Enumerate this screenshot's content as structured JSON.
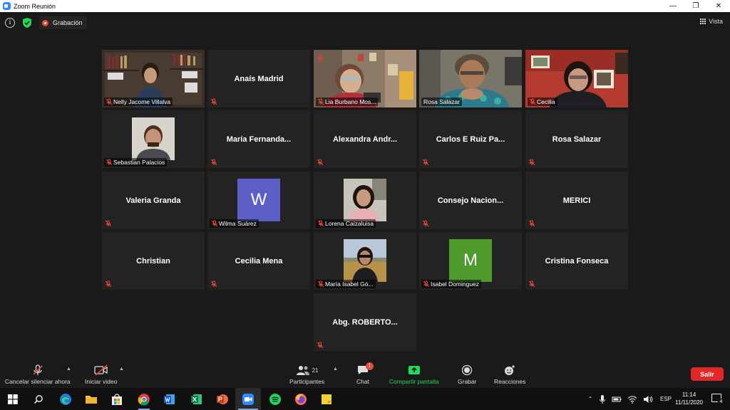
{
  "window": {
    "title": "Zoom Reunión",
    "controls": [
      "—",
      "❐",
      "✕"
    ]
  },
  "topbar": {
    "recording_label": "Grabación",
    "view_label": "Vista"
  },
  "participants": [
    {
      "name": "Nelly Jacome Villalva"
    },
    {
      "name": "Anaís Madrid"
    },
    {
      "name": "Lia Burbano Mos..."
    },
    {
      "name": "Rosa Salazar"
    },
    {
      "name": "Cecilia"
    },
    {
      "name": "Sebastian Palacios"
    },
    {
      "name": "María  Fernanda..."
    },
    {
      "name": "Alexandra  Andr..."
    },
    {
      "name": "Carlos E Ruiz Pa..."
    },
    {
      "name": "Rosa Salazar"
    },
    {
      "name": "Valeria Granda"
    },
    {
      "name": "Wilma Suárez",
      "avatar_letter": "W",
      "avatar_color": "#5b5fc7"
    },
    {
      "name": "Lorena Caizaluisa"
    },
    {
      "name": "Consejo  Nacion..."
    },
    {
      "name": "MERICI"
    },
    {
      "name": "Christian"
    },
    {
      "name": "Cecilia Mena"
    },
    {
      "name": "María Isabel Gó..."
    },
    {
      "name": "Isabel Dominguez",
      "avatar_letter": "M",
      "avatar_color": "#4e9a2d"
    },
    {
      "name": "Cristina Fonseca"
    },
    {
      "name": "Abg.  ROBERTO..."
    }
  ],
  "toolbar": {
    "unmute_label": "Cancelar silenciar ahora",
    "video_label": "Iniciar video",
    "participants_label": "Participantes",
    "participants_count": "21",
    "chat_label": "Chat",
    "chat_badge": "1",
    "share_label": "Compartir pantalla",
    "record_label": "Grabar",
    "reactions_label": "Reacciones",
    "leave_label": "Salir"
  },
  "taskbar": {
    "language": "ESP",
    "time": "11:14",
    "date": "11/11/2020",
    "notifications": "4"
  },
  "colors": {
    "accent_green": "#23d959",
    "active_speaker": "#d6e66b",
    "leave_red": "#e02828",
    "muted_red": "#e8473b"
  }
}
